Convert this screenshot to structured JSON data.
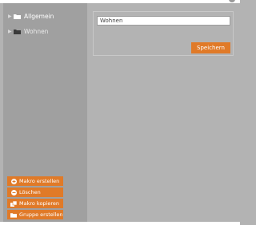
{
  "tree": {
    "items": [
      {
        "label": "Allgemein",
        "icon": "folder-icon",
        "expand_icon": "caret-right-icon"
      },
      {
        "label": "Wohnen",
        "icon": "folder-icon",
        "expand_icon": "caret-right-icon"
      }
    ]
  },
  "form": {
    "name_value": "Wohnen",
    "save_label": "Speichern"
  },
  "actions": [
    {
      "label": "Makro erstellen",
      "icon": "plus-circle-icon"
    },
    {
      "label": "Löschen",
      "icon": "minus-circle-icon"
    },
    {
      "label": "Makro kopieren",
      "icon": "copy-icon"
    },
    {
      "label": "Gruppe erstellen",
      "icon": "folder-icon"
    }
  ],
  "colors": {
    "accent": "#e07a28",
    "sidebar_bg": "#a0a0a0",
    "main_bg": "#b3b3b3"
  }
}
